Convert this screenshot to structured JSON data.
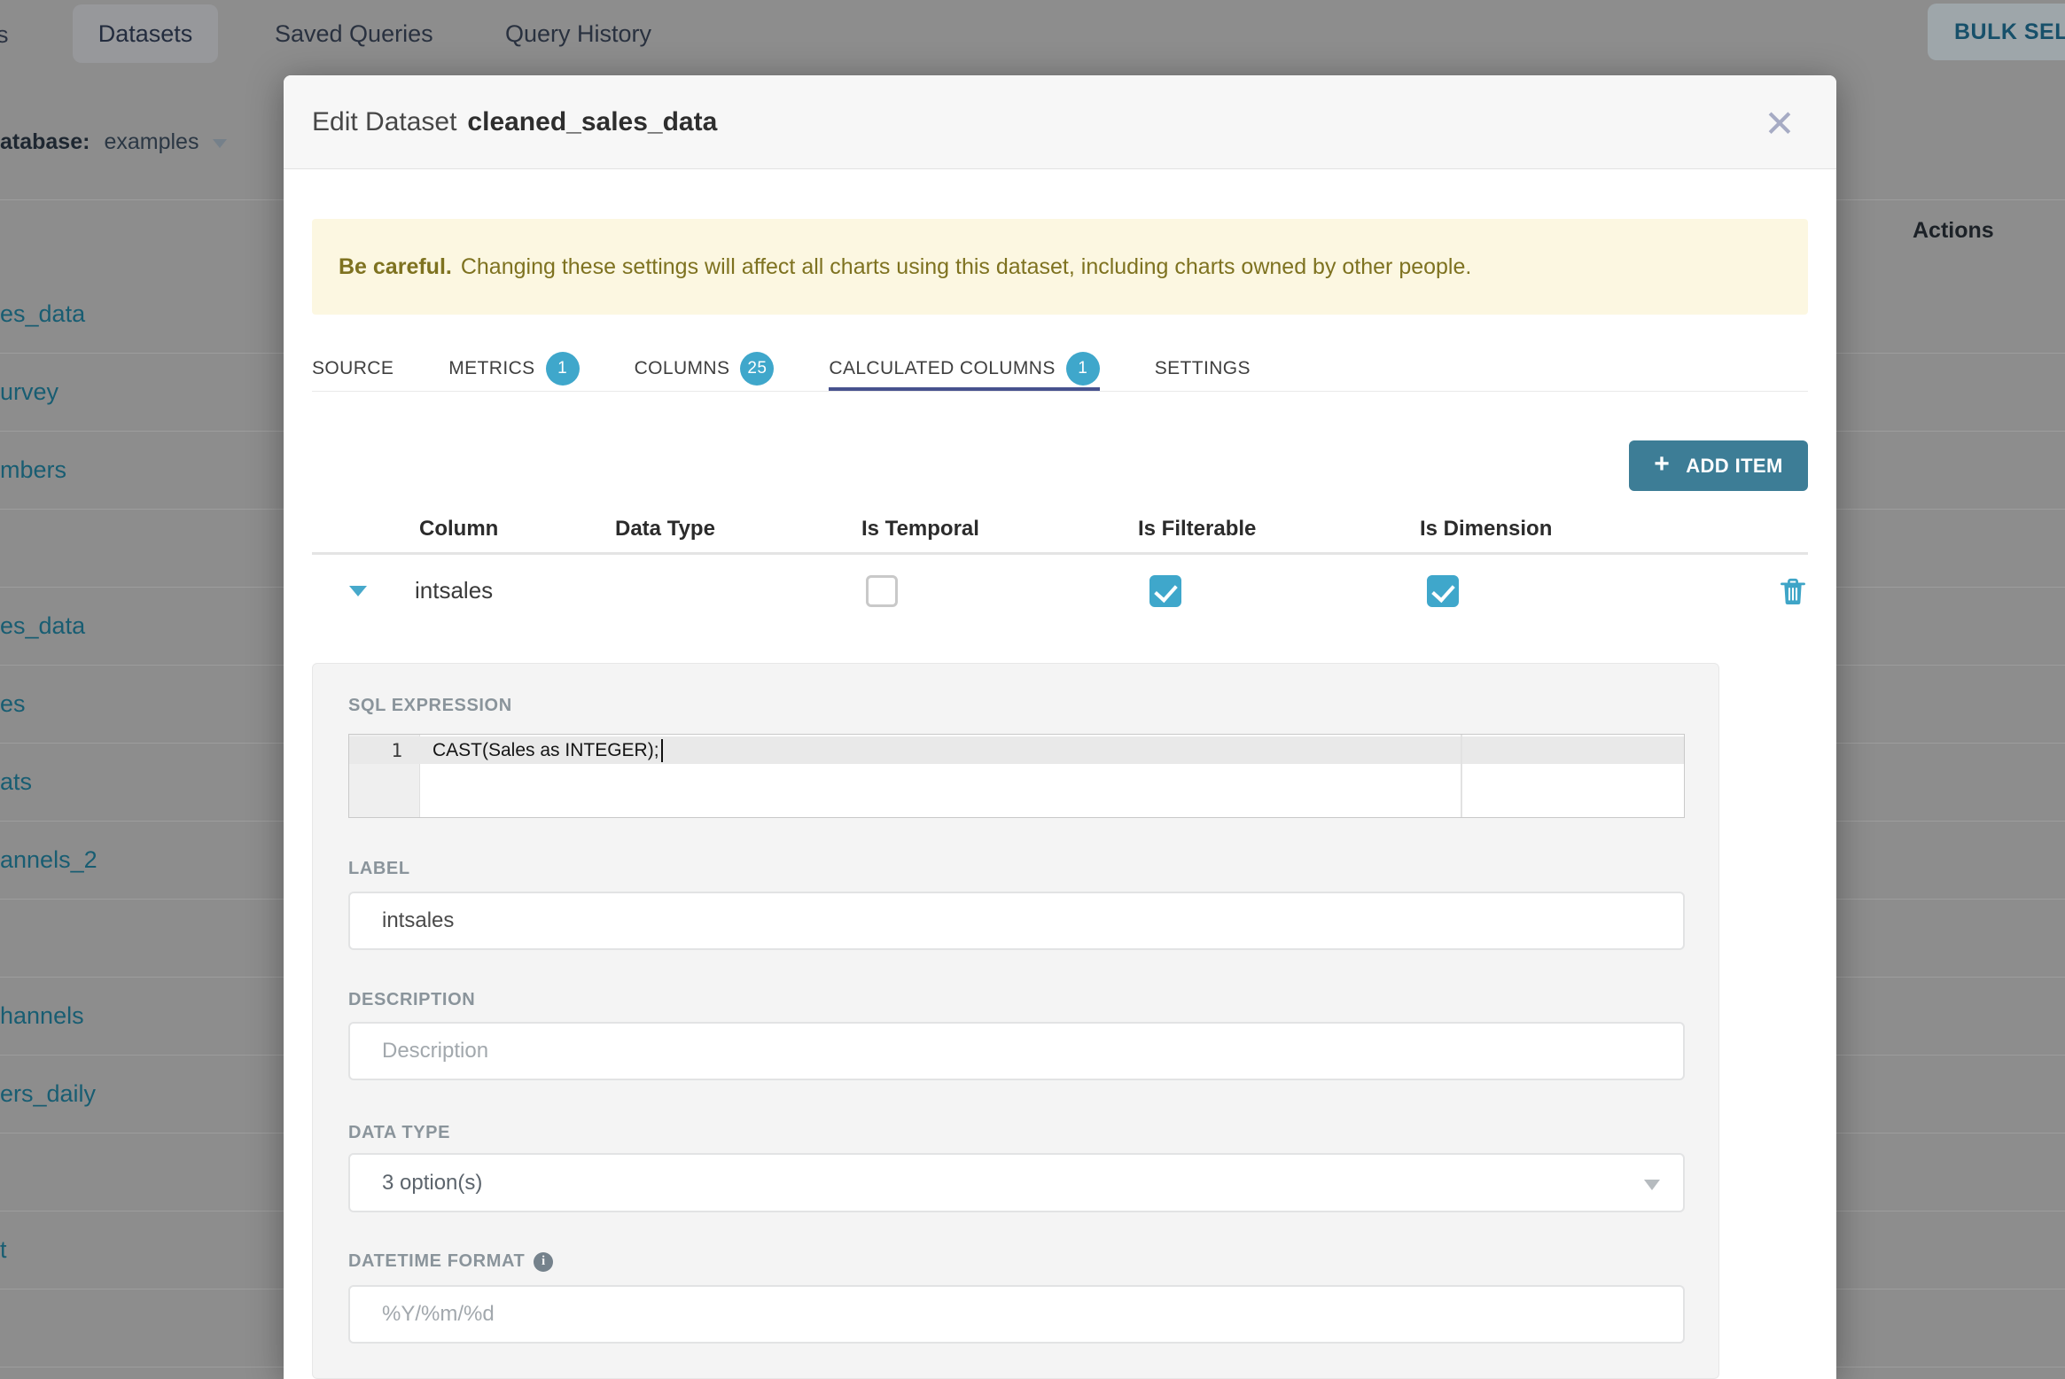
{
  "background": {
    "nav": {
      "cut_tab_fragment": "s",
      "active_tab": "Datasets",
      "tabs": [
        "Saved Queries",
        "Query History"
      ],
      "bulk_select_label": "BULK SELECT"
    },
    "filter": {
      "label": "atabase:",
      "value": "examples"
    },
    "table": {
      "actions_header": "Actions",
      "dataset_rows": [
        "es_data",
        "urvey",
        "mbers",
        "",
        "es_data",
        "es",
        "ats",
        "annels_2",
        "",
        "hannels",
        "ers_daily",
        "",
        "t",
        ""
      ]
    }
  },
  "modal": {
    "title_prefix": "Edit Dataset",
    "dataset_name": "cleaned_sales_data",
    "close_glyph": "✕",
    "warning": {
      "bold": "Be careful.",
      "text": "Changing these settings will affect all charts using this dataset, including charts owned by other people."
    },
    "tabs": [
      {
        "label": "SOURCE",
        "badge": null,
        "active": false
      },
      {
        "label": "METRICS",
        "badge": "1",
        "active": false
      },
      {
        "label": "COLUMNS",
        "badge": "25",
        "active": false
      },
      {
        "label": "CALCULATED COLUMNS",
        "badge": "1",
        "active": true
      },
      {
        "label": "SETTINGS",
        "badge": null,
        "active": false
      }
    ],
    "add_item": {
      "plus": "+",
      "label": "ADD ITEM"
    },
    "columns_table": {
      "headers": [
        "Column",
        "Data Type",
        "Is Temporal",
        "Is Filterable",
        "Is Dimension"
      ],
      "row": {
        "name": "intsales",
        "is_temporal": false,
        "is_filterable": true,
        "is_dimension": true
      }
    },
    "editor_panel": {
      "sql_label": "SQL EXPRESSION",
      "line_number": "1",
      "sql_code": "CAST(Sales as INTEGER);",
      "label_field": {
        "label": "LABEL",
        "value": "intsales"
      },
      "description_field": {
        "label": "DESCRIPTION",
        "placeholder": "Description"
      },
      "data_type_field": {
        "label": "DATA TYPE",
        "value": "3 option(s)"
      },
      "datetime_field": {
        "label": "DATETIME FORMAT",
        "info": "i",
        "placeholder": "%Y/%m/%d"
      }
    }
  },
  "colors": {
    "accent_cyan": "#3fa7cb",
    "tab_underline": "#47528e",
    "add_button": "#3d7d96",
    "banner_bg": "#fcf7e1",
    "banner_text": "#7e7220",
    "backdrop": "#8d8d8d",
    "link_dimmed": "#185d72"
  }
}
